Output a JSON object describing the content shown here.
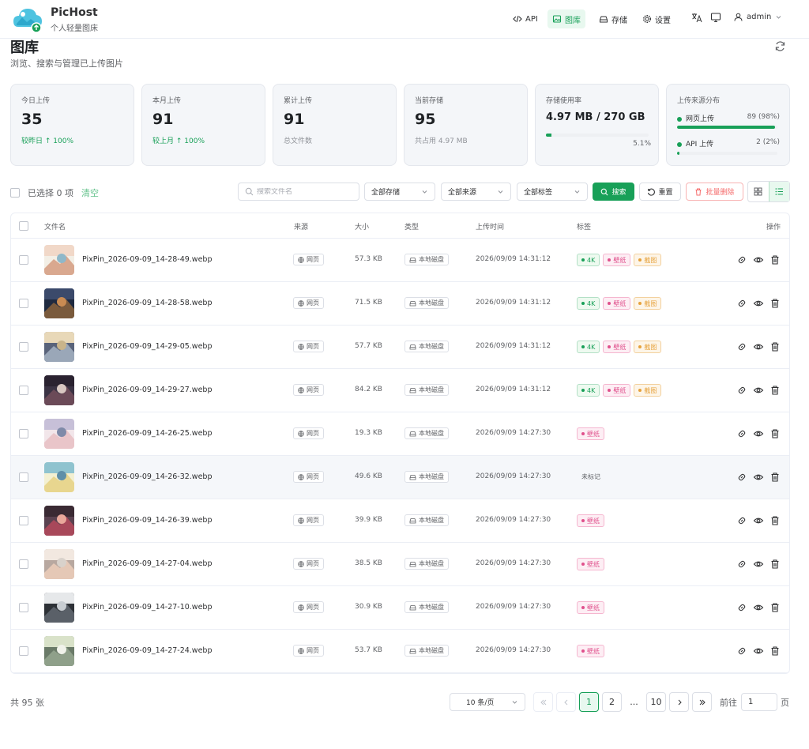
{
  "header": {
    "brand": "PicHost",
    "brand_sub": "个人轻量图床",
    "nav": [
      {
        "label": "API",
        "active": false
      },
      {
        "label": "图库",
        "active": true
      },
      {
        "label": "存储",
        "active": false
      },
      {
        "label": "设置",
        "active": false
      }
    ],
    "user": "admin"
  },
  "page": {
    "title": "图库",
    "subtitle": "浏览、搜索与管理已上传图片"
  },
  "stats": {
    "today": {
      "label": "今日上传",
      "value": "35",
      "foot": "较昨日 ↑ 100%"
    },
    "month": {
      "label": "本月上传",
      "value": "91",
      "foot": "较上月 ↑ 100%"
    },
    "total": {
      "label": "累计上传",
      "value": "91",
      "foot": "总文件数"
    },
    "current": {
      "label": "当前存储",
      "value": "95",
      "foot": "共占用 4.97 MB"
    },
    "usage": {
      "label": "存储使用率",
      "value": "4.97 MB / 270 GB",
      "percent_text": "5.1%",
      "fraction": 0.051
    },
    "sources": {
      "label": "上传来源分布",
      "web": {
        "label": "网页上传",
        "count": "89 (98%)",
        "fraction": 0.98
      },
      "api": {
        "label": "API 上传",
        "count": "2 (2%)",
        "fraction": 0.02
      }
    }
  },
  "toolbar": {
    "selected": "已选择 0 项",
    "clear": "清空",
    "search_placeholder": "搜索文件名",
    "storage_filter": "全部存储",
    "source_filter": "全部来源",
    "tag_filter": "全部标签",
    "search_btn": "搜索",
    "reset_btn": "重置",
    "batch_delete_btn": "批量删除"
  },
  "table": {
    "headers": {
      "name": "文件名",
      "source": "来源",
      "size": "大小",
      "type": "类型",
      "time": "上传时间",
      "tags": "标签",
      "actions": "操作"
    },
    "rows": [
      {
        "name": "PixPin_2026-09-09_14-28-49.webp",
        "source": "网页",
        "size": "57.3 KB",
        "type": "本地磁盘",
        "time": "2026/09/09 14:31:12",
        "tags": [
          "4K",
          "壁纸",
          "截图"
        ],
        "untagged": ""
      },
      {
        "name": "PixPin_2026-09-09_14-28-58.webp",
        "source": "网页",
        "size": "71.5 KB",
        "type": "本地磁盘",
        "time": "2026/09/09 14:31:12",
        "tags": [
          "4K",
          "壁纸",
          "截图"
        ],
        "untagged": ""
      },
      {
        "name": "PixPin_2026-09-09_14-29-05.webp",
        "source": "网页",
        "size": "57.7 KB",
        "type": "本地磁盘",
        "time": "2026/09/09 14:31:12",
        "tags": [
          "4K",
          "壁纸",
          "截图"
        ],
        "untagged": ""
      },
      {
        "name": "PixPin_2026-09-09_14-29-27.webp",
        "source": "网页",
        "size": "84.2 KB",
        "type": "本地磁盘",
        "time": "2026/09/09 14:31:12",
        "tags": [
          "4K",
          "壁纸",
          "截图"
        ],
        "untagged": ""
      },
      {
        "name": "PixPin_2026-09-09_14-26-25.webp",
        "source": "网页",
        "size": "19.3 KB",
        "type": "本地磁盘",
        "time": "2026/09/09 14:27:30",
        "tags": [
          "壁纸"
        ],
        "untagged": ""
      },
      {
        "name": "PixPin_2026-09-09_14-26-32.webp",
        "source": "网页",
        "size": "49.6 KB",
        "type": "本地磁盘",
        "time": "2026/09/09 14:27:30",
        "tags": [],
        "untagged": "未标记"
      },
      {
        "name": "PixPin_2026-09-09_14-26-39.webp",
        "source": "网页",
        "size": "39.9 KB",
        "type": "本地磁盘",
        "time": "2026/09/09 14:27:30",
        "tags": [
          "壁纸"
        ],
        "untagged": ""
      },
      {
        "name": "PixPin_2026-09-09_14-27-04.webp",
        "source": "网页",
        "size": "38.5 KB",
        "type": "本地磁盘",
        "time": "2026/09/09 14:27:30",
        "tags": [
          "壁纸"
        ],
        "untagged": ""
      },
      {
        "name": "PixPin_2026-09-09_14-27-10.webp",
        "source": "网页",
        "size": "30.9 KB",
        "type": "本地磁盘",
        "time": "2026/09/09 14:27:30",
        "tags": [
          "壁纸"
        ],
        "untagged": ""
      },
      {
        "name": "PixPin_2026-09-09_14-27-24.webp",
        "source": "网页",
        "size": "53.7 KB",
        "type": "本地磁盘",
        "time": "2026/09/09 14:27:30",
        "tags": [
          "壁纸"
        ],
        "untagged": ""
      }
    ]
  },
  "pagination": {
    "total": "共 95 张",
    "page_size": "10 条/页",
    "pages": [
      "1",
      "2",
      "...",
      "10"
    ],
    "goto_label": "前往",
    "goto_value": "1",
    "goto_suffix": "页"
  },
  "colors": {
    "accent": "#18a058",
    "danger": "#f56c6c",
    "tag_4k": "#18a058",
    "tag_wallpaper": "#e0508c",
    "tag_screenshot": "#e6a23c"
  }
}
